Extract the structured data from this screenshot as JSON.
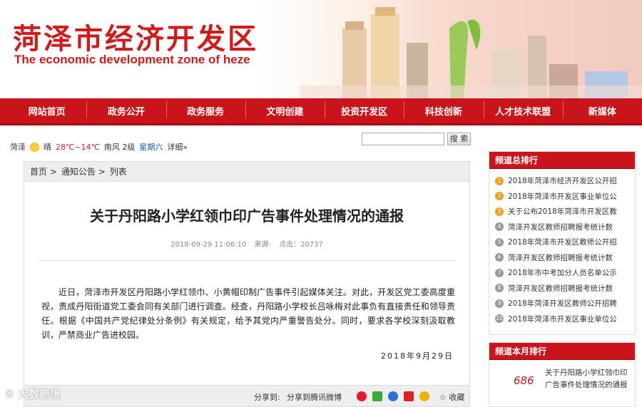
{
  "header": {
    "logo_cn": "菏泽市经济开发区",
    "logo_en": "The economic development zone of heze"
  },
  "nav": {
    "items": [
      "网站首页",
      "政务公开",
      "政务服务",
      "文明创建",
      "投资开发区",
      "科技创新",
      "人才技术联盟",
      "新媒体"
    ]
  },
  "weather": {
    "city": "菏泽",
    "condition": "晴",
    "temp": "28℃~14℃",
    "wind": "南风 2级",
    "weekday": "星期六",
    "details_link": "详细»",
    "icon": "sun-icon"
  },
  "search": {
    "button_label": "搜 索",
    "value": ""
  },
  "breadcrumb": [
    "首页 >",
    "通知公告 >",
    "列表"
  ],
  "article": {
    "title": "关于丹阳路小学红领巾印广告事件处理情况的通报",
    "datetime": "2018-09-29 11:06:10",
    "source_label": "来源:",
    "hits_label": "点击：20737",
    "body": "近日，菏泽市开发区丹阳路小学红领巾、小黄帽印制广告事件引起媒体关注。对此，开发区党工委高度重视，责成丹阳街道党工委会同有关部门进行调查。经查，丹阳路小学校长吕咏梅对此事负有直接责任和领导责任。根据《中国共产党纪律处分条例》有关规定，给予其党内严重警告处分。同时，要求各学校深刻汲取教训，严禁商业广告进校园。",
    "sign_date": "2018年9月29日"
  },
  "share": {
    "label": "分享到:",
    "weibo": "分享到腾讯微博",
    "collect": "收藏",
    "icon_colors": [
      "#e6162d",
      "#3ba935",
      "#2a6fd6",
      "#e02020",
      "#f0b400"
    ]
  },
  "sidebar_total": {
    "title": "频道总排行",
    "items": [
      {
        "n": "1",
        "text": "2018年菏泽市经济开发区公开招"
      },
      {
        "n": "2",
        "text": "2018年菏泽市开发区事业单位公"
      },
      {
        "n": "3",
        "text": "关于公布2018年菏泽市开发区教"
      },
      {
        "n": "4",
        "text": "菏泽开发区教师招聘报考统计数"
      },
      {
        "n": "5",
        "text": "2018年菏泽市开发区教师公开招"
      },
      {
        "n": "6",
        "text": "菏泽开发区教师招聘报考统计数"
      },
      {
        "n": "7",
        "text": "2018年市中考加分人员名单公示"
      },
      {
        "n": "8",
        "text": "菏泽开发区教师招聘报考统计数"
      },
      {
        "n": "9",
        "text": "2018年菏泽开发区教师公开招聘"
      },
      {
        "n": "10",
        "text": "2018年菏泽市开发区事业单位公"
      }
    ]
  },
  "sidebar_month": {
    "title": "频道本月排行",
    "count": "686",
    "item": "关于丹阳路小学红领巾印广告事件处理情况的通报"
  },
  "watermark": {
    "text": "大数跨境"
  }
}
